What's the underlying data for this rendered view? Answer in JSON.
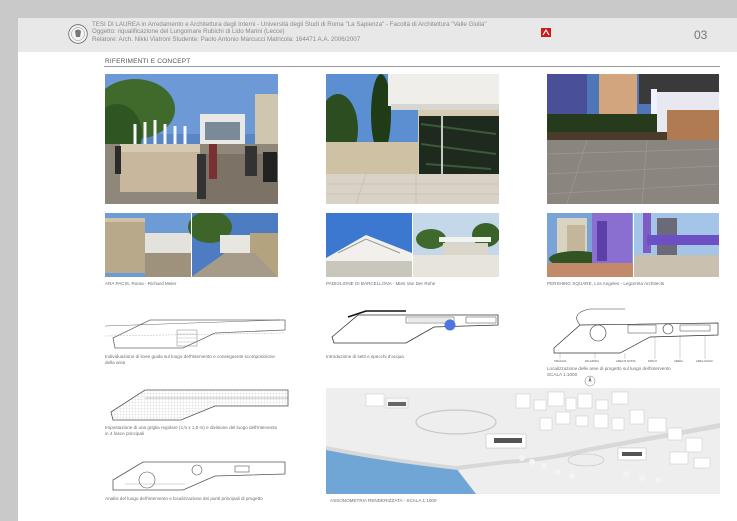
{
  "header": {
    "line1": "TESI DI LAUREA  in Arredamento e Architettura degli Interni - Università degli Studi di Roma \"La Sapienza\" - Facoltà di Architettura \"Valle Giulia\"",
    "line2": "Oggetto: riqualificazione del Lungomare Rubichi di Lido Marini (Lecce)",
    "line3": "Relatore: Arch. Nikki Viatroni        Studente: Paolo Antonio Marcucci   Matricola: 164471   A.A. 2006/2007",
    "page_number": "03"
  },
  "section": {
    "title": "RIFERIMENTI E CONCEPT"
  },
  "references": [
    {
      "caption": "ARA PACIS, Roma - Richard Meier"
    },
    {
      "caption": "PADIGLIONE DI BARCELLONA - Mies Van Der Rohe"
    },
    {
      "caption": "PERSHING SQUARE, Los Angeles - Legorreta Architects"
    }
  ],
  "concept": [
    {
      "caption": "Individuazione di linee guida sul luogo dell'intervento e conseguente scomposizione della area"
    },
    {
      "caption": "Impostazione di una griglia regolare (1,5 x 1,5 m) e divisione del luogo dell'intervento in 4 fasce principali"
    },
    {
      "caption": "Analisi del luogo dell'intervento e localizzazione dei punti principali di progetto"
    }
  ],
  "pavilion": {
    "caption": "Introduzione di setti e specchi d'acqua"
  },
  "site_plan": {
    "caption_line1": "Localizzazione delle aree di progetto sul luogo dell'intervento",
    "caption_line2": "SCALA 1:1000",
    "labels": [
      "SPIAGGIA",
      "PALAZZINA",
      "AREA DI SOSTA",
      "PARCO",
      "ARENA",
      "AREA GIOCHI"
    ]
  },
  "axonometry": {
    "caption": "ASSONOMETRIA RENDERIZZATA - SCALA 1:1000"
  },
  "colors": {
    "accent_red": "#d01a1a",
    "water_blue": "#6fa6d6",
    "plan_circle_blue": "#4f76e0"
  }
}
